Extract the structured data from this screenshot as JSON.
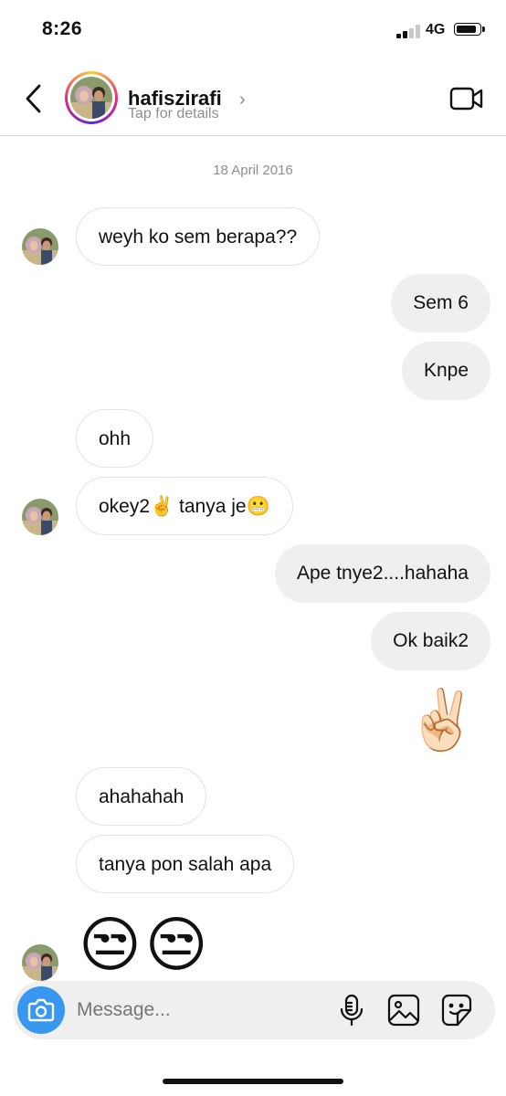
{
  "status_bar": {
    "time": "8:26",
    "network": "4G"
  },
  "header": {
    "username": "hafiszirafi",
    "subtitle": "Tap for details",
    "back_icon": "chevron-left-icon",
    "video_icon": "video-camera-icon"
  },
  "chat": {
    "date": "18 April 2016",
    "messages": [
      {
        "from": "them",
        "text": "weyh ko sem berapa??"
      },
      {
        "from": "me",
        "text": "Sem 6"
      },
      {
        "from": "me",
        "text": "Knpe"
      },
      {
        "from": "them",
        "text": "ohh"
      },
      {
        "from": "them",
        "text": "okey2✌️ tanya je😬"
      },
      {
        "from": "me",
        "text": "Ape tnye2....hahaha"
      },
      {
        "from": "me",
        "text": "Ok baik2"
      },
      {
        "from": "me",
        "text": "✌🏻"
      },
      {
        "from": "them",
        "text": "ahahahah"
      },
      {
        "from": "them",
        "text": "tanya pon salah apa"
      },
      {
        "from": "them",
        "text": "😒😒"
      }
    ]
  },
  "composer": {
    "placeholder": "Message...",
    "icons": [
      "camera-icon",
      "microphone-icon",
      "gallery-icon",
      "sticker-icon"
    ]
  },
  "colors": {
    "accent": "#3897f0",
    "outgoing_bubble": "#efefef",
    "incoming_border": "#e3e3e3"
  }
}
